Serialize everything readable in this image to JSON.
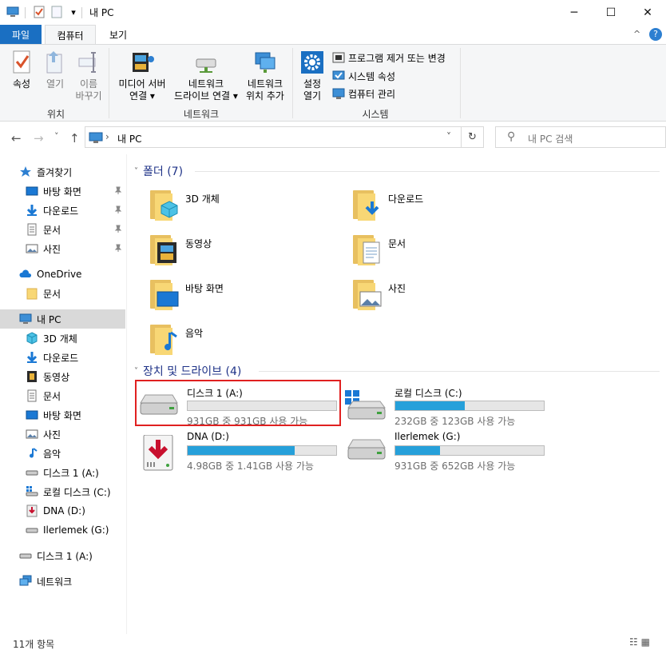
{
  "window": {
    "title": "내 PC",
    "controls": {
      "minimize": "─",
      "maximize": "☐",
      "close": "✕"
    },
    "qa_dropdown": "▾"
  },
  "tabs": {
    "file": "파일",
    "computer": "컴퓨터",
    "view": "보기",
    "help": "?",
    "collapse": "^"
  },
  "ribbon": {
    "location": {
      "label": "위치",
      "properties": "속성",
      "open": "열기",
      "rename_line1": "이름",
      "rename_line2": "바꾸기"
    },
    "network": {
      "label": "네트워크",
      "media_line1": "미디어 서버",
      "media_line2": "연결 ▾",
      "map_line1": "네트워크",
      "map_line2": "드라이브 연결 ▾",
      "add_line1": "네트워크",
      "add_line2": "위치 추가"
    },
    "system": {
      "label": "시스템",
      "settings_line1": "설정",
      "settings_line2": "열기",
      "uninstall": "프로그램 제거 또는 변경",
      "properties": "시스템 속성",
      "manage": "컴퓨터 관리"
    }
  },
  "nav": {
    "back": "←",
    "forward": "→",
    "recent": "˅",
    "up": "↑"
  },
  "address": {
    "path": "내 PC",
    "separator": "›",
    "dropdown": "˅",
    "refresh": "↻"
  },
  "search": {
    "placeholder": "내 PC 검색",
    "icon": "⚲"
  },
  "sidebar": {
    "quick_access": "즐겨찾기",
    "qa_items": [
      "바탕 화면",
      "다운로드",
      "문서",
      "사진"
    ],
    "pin": "📌",
    "onedrive": "OneDrive",
    "onedrive_items": [
      "문서"
    ],
    "this_pc": "내 PC",
    "pc_items": [
      "3D 개체",
      "다운로드",
      "동영상",
      "문서",
      "바탕 화면",
      "사진",
      "음악",
      "디스크 1 (A:)",
      "로컬 디스크 (C:)",
      "DNA (D:)",
      "Ilerlemek (G:)"
    ],
    "disk_root": "디스크 1 (A:)",
    "network": "네트워크"
  },
  "folders_section": {
    "title": "폴더 (7)",
    "chevron": "˅",
    "items": [
      "3D 개체",
      "다운로드",
      "동영상",
      "문서",
      "바탕 화면",
      "사진",
      "음악"
    ]
  },
  "drives_section": {
    "title": "장치 및 드라이브 (4)",
    "chevron": "˅",
    "items": [
      {
        "name": "디스크 1 (A:)",
        "info": "931GB 중 931GB 사용 가능",
        "used_fraction": 0.0
      },
      {
        "name": "로컬 디스크 (C:)",
        "info": "232GB 중 123GB 사용 가능",
        "used_fraction": 0.47
      },
      {
        "name": "DNA (D:)",
        "info": "4.98GB 중 1.41GB 사용 가능",
        "used_fraction": 0.72
      },
      {
        "name": "Ilerlemek (G:)",
        "info": "931GB 중 652GB 사용 가능",
        "used_fraction": 0.3
      }
    ]
  },
  "status": {
    "count": "11개 항목",
    "view_icons": "☷ ▦"
  },
  "colors": {
    "accent": "#1a6fc2",
    "bar": "#26a0da",
    "highlight": "#e02020",
    "folder": "#f8d775"
  }
}
